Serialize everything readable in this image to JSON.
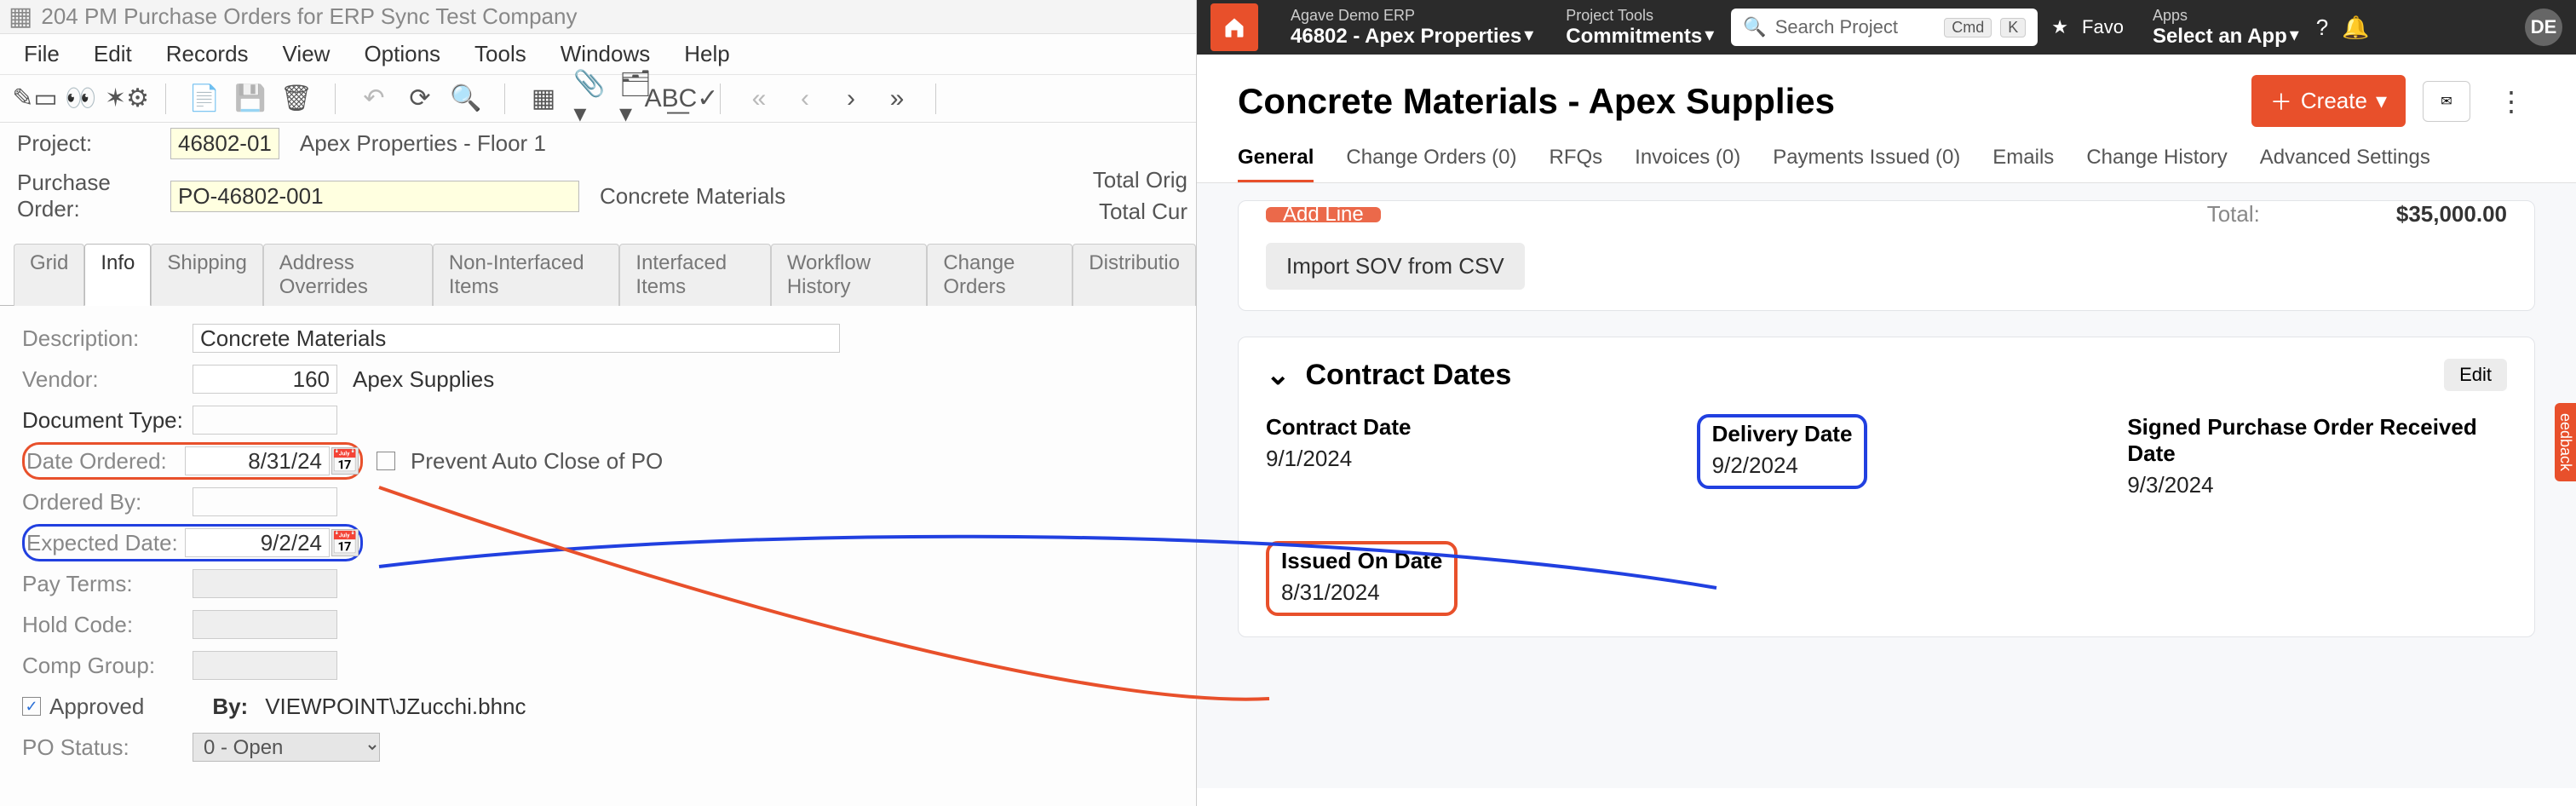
{
  "erp": {
    "window_title": "204 PM Purchase Orders for ERP Sync Test Company",
    "menu": [
      "File",
      "Edit",
      "Records",
      "View",
      "Options",
      "Tools",
      "Windows",
      "Help"
    ],
    "header": {
      "project_label": "Project:",
      "project_no": "46802-01",
      "project_name": "Apex Properties - Floor 1",
      "po_label": "Purchase Order:",
      "po_no": "PO-46802-001",
      "po_desc": "Concrete Materials",
      "total_orig": "Total Orig",
      "total_cur": "Total Cur"
    },
    "tabs": [
      "Grid",
      "Info",
      "Shipping",
      "Address Overrides",
      "Non-Interfaced Items",
      "Interfaced Items",
      "Workflow History",
      "Change Orders",
      "Distributio"
    ],
    "active_tab": "Info",
    "form": {
      "description_label": "Description:",
      "description": "Concrete Materials",
      "vendor_label": "Vendor:",
      "vendor_no": "160",
      "vendor_name": "Apex Supplies",
      "doc_type_label": "Document Type:",
      "date_ordered_label": "Date Ordered:",
      "date_ordered": "8/31/24",
      "prevent_auto_close": "Prevent Auto Close of PO",
      "ordered_by_label": "Ordered By:",
      "expected_label": "Expected Date:",
      "expected": "9/2/24",
      "pay_terms_label": "Pay Terms:",
      "hold_code_label": "Hold Code:",
      "comp_group_label": "Comp Group:",
      "approved_label": "Approved",
      "by_label": "By:",
      "by_value": "VIEWPOINT\\JZucchi.bhnc",
      "status_label": "PO Status:",
      "status_value": "0 - Open"
    }
  },
  "web": {
    "top": {
      "erp_line1": "Agave Demo ERP",
      "erp_line2": "46802 - Apex Properties",
      "tools_line1": "Project Tools",
      "tools_line2": "Commitments",
      "search_placeholder": "Search Project",
      "kbd1": "Cmd",
      "kbd2": "K",
      "fav": "Favo",
      "apps_line1": "Apps",
      "apps_line2": "Select an App",
      "avatar": "DE"
    },
    "title": "Concrete Materials - Apex Supplies",
    "create": "Create",
    "subnav": [
      "General",
      "Change Orders (0)",
      "RFQs",
      "Invoices (0)",
      "Payments Issued (0)",
      "Emails",
      "Change History",
      "Advanced Settings"
    ],
    "top_card": {
      "add_line": "Add Line",
      "total_label": "Total:",
      "total_value": "$35,000.00",
      "import": "Import SOV from CSV"
    },
    "dates": {
      "section": "Contract Dates",
      "edit": "Edit",
      "contract_label": "Contract Date",
      "contract_value": "9/1/2024",
      "delivery_label": "Delivery Date",
      "delivery_value": "9/2/2024",
      "signed_label": "Signed Purchase Order Received Date",
      "signed_value": "9/3/2024",
      "issued_label": "Issued On Date",
      "issued_value": "8/31/2024"
    },
    "feedback": "eedback"
  }
}
